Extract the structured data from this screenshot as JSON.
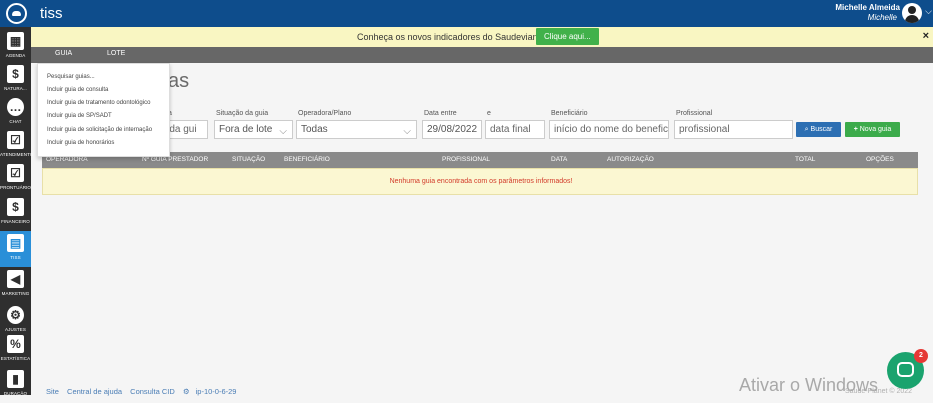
{
  "app": {
    "title": "tiss"
  },
  "user": {
    "name": "Michelle Almeida",
    "sub": "Michelle"
  },
  "sidebar": {
    "items": [
      {
        "label": "AGENDA",
        "icon": "calendar-icon",
        "glyph": "▦"
      },
      {
        "label": "NATURA...",
        "icon": "dollar-icon",
        "glyph": "$"
      },
      {
        "label": "CHAT",
        "icon": "chat-icon",
        "glyph": "…"
      },
      {
        "label": "ATENDIMENTO",
        "icon": "checklist-icon",
        "glyph": "☑"
      },
      {
        "label": "PRONTUÁRIO",
        "icon": "checklist-icon",
        "glyph": "☑"
      },
      {
        "label": "FINANCEIRO",
        "icon": "dollar-icon",
        "glyph": "$"
      },
      {
        "label": "TISS",
        "icon": "card-icon",
        "glyph": "▤"
      },
      {
        "label": "MARKETING",
        "icon": "megaphone-icon",
        "glyph": "◀"
      },
      {
        "label": "AJUSTES",
        "icon": "gears-icon",
        "glyph": "⚙"
      },
      {
        "label": "ESTATÍSTICA",
        "icon": "percent-icon",
        "glyph": "%"
      },
      {
        "label": "DURAÇÃO",
        "icon": "bars-icon",
        "glyph": "▮"
      }
    ]
  },
  "banner": {
    "text": "Conheça os novos indicadores do Saudevianet.",
    "button": "Clique aqui...",
    "close": "×"
  },
  "menu": {
    "guia": "GUIA",
    "lote": "LOTE"
  },
  "dropdown": {
    "items": [
      "Pesquisar guias...",
      "Incluir guia de consulta",
      "Incluir guia de tratamento odontológico",
      "Incluir guia de SP/SADT",
      "Incluir guia de solicitação de internação",
      "Incluir guia de honorários"
    ]
  },
  "page": {
    "title": "as"
  },
  "filters": {
    "guia_label": "a",
    "guia_value": "o da gui",
    "situacao_label": "Situação da guia",
    "situacao_value": "Fora de lote",
    "operadora_label": "Operadora/Plano",
    "operadora_value": "Todas",
    "data_label": "Data entre",
    "data_inicio": "29/08/2022",
    "e_label": "e",
    "data_final_placeholder": "data final",
    "beneficiario_label": "Beneficiário",
    "beneficiario_placeholder": "início do nome do benefici",
    "profissional_label": "Profissional",
    "profissional_placeholder": "profissional",
    "buscar": "Buscar",
    "nova_guia": "Nova guia"
  },
  "table": {
    "headers": [
      "OPERADORA",
      "Nº GUIA PRESTADOR",
      "SITUAÇÃO",
      "BENEFICIÁRIO",
      "PROFISSIONAL",
      "DATA",
      "AUTORIZAÇÃO",
      "TOTAL",
      "OPÇÕES"
    ],
    "empty_message": "Nenhuma guia encontrada com os parâmetros informados!"
  },
  "footer": {
    "links": [
      "Site",
      "Central de ajuda",
      "Consulta CID",
      "ip-10-0-6-29"
    ]
  },
  "watermark": "Ativar o Windows",
  "copyright": "Saude-Planet © 2022",
  "chat": {
    "badge": "2"
  }
}
